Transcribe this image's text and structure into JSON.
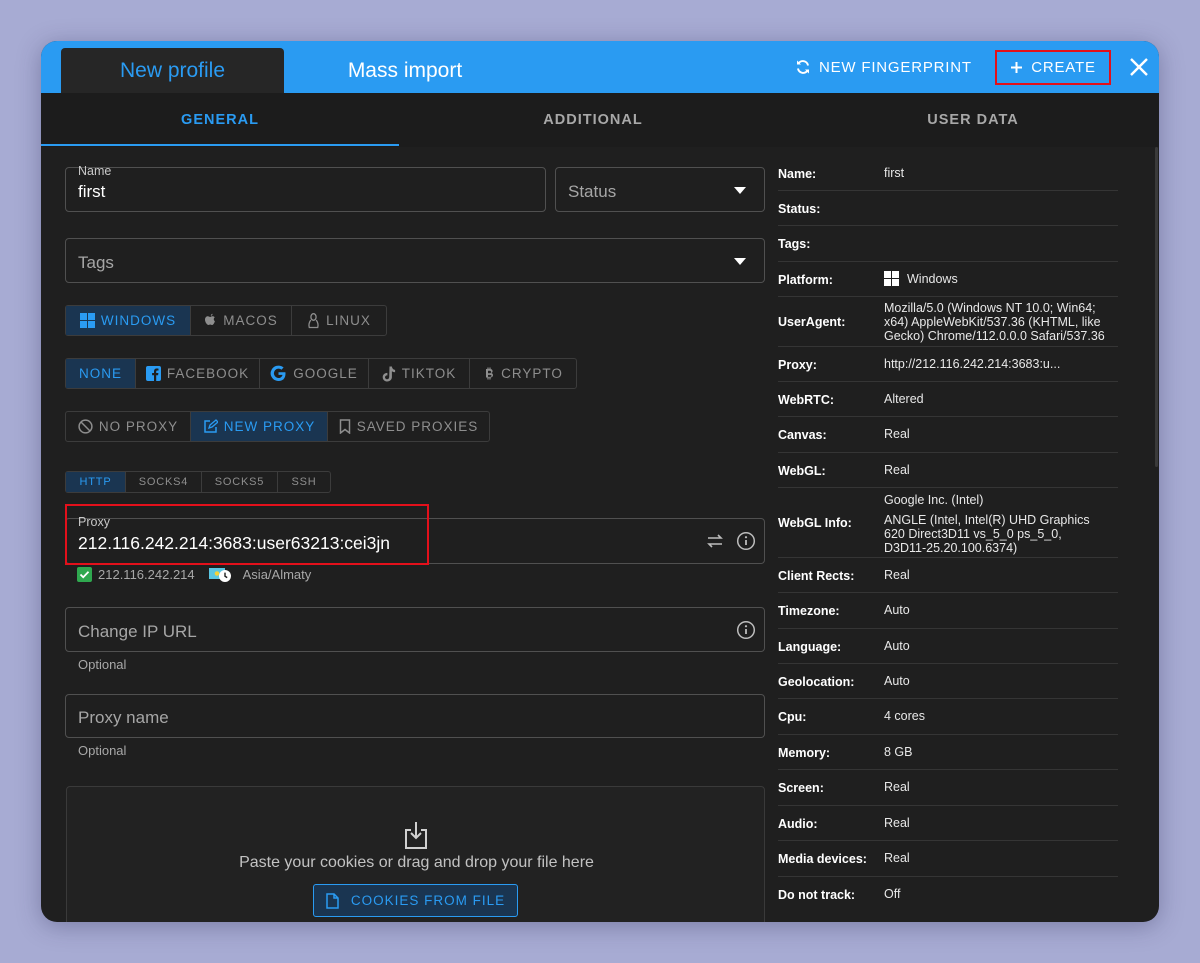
{
  "header": {
    "tab_new_profile": "New profile",
    "tab_mass_import": "Mass import",
    "new_fingerprint_label": "NEW FINGERPRINT",
    "create_label": "CREATE",
    "accent_color": "#2a9bf2"
  },
  "subtabs": {
    "general": "GENERAL",
    "additional": "ADDITIONAL",
    "user_data": "USER DATA"
  },
  "form": {
    "name_label": "Name",
    "name_value": "first",
    "status_placeholder": "Status",
    "tags_placeholder": "Tags",
    "os_options": [
      "WINDOWS",
      "MACOS",
      "LINUX"
    ],
    "os_selected": "WINDOWS",
    "template_options": [
      "NONE",
      "FACEBOOK",
      "GOOGLE",
      "TIKTOK",
      "CRYPTO"
    ],
    "template_selected": "NONE",
    "proxy_modes": [
      "NO PROXY",
      "NEW PROXY",
      "SAVED PROXIES"
    ],
    "proxy_mode_selected": "NEW PROXY",
    "proxy_types": [
      "HTTP",
      "SOCKS4",
      "SOCKS5",
      "SSH"
    ],
    "proxy_type_selected": "HTTP",
    "proxy_label": "Proxy",
    "proxy_value": "212.116.242.214:3683:user63213:cei3jn",
    "proxy_check_ip": "212.116.242.214",
    "proxy_timezone": "Asia/Almaty",
    "change_ip_placeholder": "Change IP URL",
    "change_ip_helper": "Optional",
    "proxy_name_placeholder": "Proxy name",
    "proxy_name_helper": "Optional",
    "cookies_text": "Paste your cookies or drag and drop your file here",
    "cookies_button": "COOKIES FROM FILE"
  },
  "user_data": [
    {
      "key": "Name:",
      "value": "first"
    },
    {
      "key": "Status:",
      "value": ""
    },
    {
      "key": "Tags:",
      "value": ""
    },
    {
      "key": "Platform:",
      "value": "Windows"
    },
    {
      "key": "UserAgent:",
      "value": "Mozilla/5.0 (Windows NT 10.0; Win64; x64) AppleWebKit/537.36 (KHTML, like Gecko) Chrome/112.0.0.0 Safari/537.36"
    },
    {
      "key": "Proxy:",
      "value": "http://212.116.242.214:3683:u..."
    },
    {
      "key": "WebRTC:",
      "value": "Altered"
    },
    {
      "key": "Canvas:",
      "value": "Real"
    },
    {
      "key": "WebGL:",
      "value": "Real"
    },
    {
      "key": "WebGL Info:",
      "value_line1": "Google Inc. (Intel)",
      "value_line2": "ANGLE (Intel, Intel(R) UHD Graphics 620 Direct3D11 vs_5_0 ps_5_0, D3D11-25.20.100.6374)"
    },
    {
      "key": "Client Rects:",
      "value": "Real"
    },
    {
      "key": "Timezone:",
      "value": "Auto"
    },
    {
      "key": "Language:",
      "value": "Auto"
    },
    {
      "key": "Geolocation:",
      "value": "Auto"
    },
    {
      "key": "Cpu:",
      "value": "4 cores"
    },
    {
      "key": "Memory:",
      "value": "8 GB"
    },
    {
      "key": "Screen:",
      "value": "Real"
    },
    {
      "key": "Audio:",
      "value": "Real"
    },
    {
      "key": "Media devices:",
      "value": "Real"
    },
    {
      "key": "Do not track:",
      "value": "Off"
    }
  ]
}
